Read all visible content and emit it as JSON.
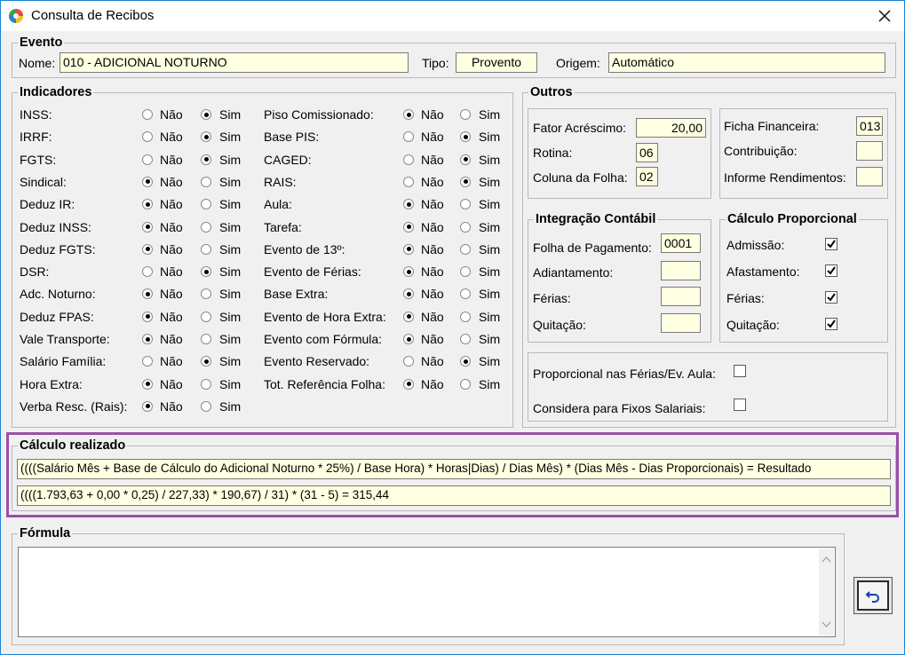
{
  "window": {
    "title": "Consulta de Recibos"
  },
  "evento": {
    "group_label": "Evento",
    "nome_label": "Nome:",
    "nome_value": "010 - ADICIONAL NOTURNO",
    "tipo_label": "Tipo:",
    "tipo_value": "Provento",
    "origem_label": "Origem:",
    "origem_value": "Automático"
  },
  "indicadores": {
    "group_label": "Indicadores",
    "no_label": "Não",
    "yes_label": "Sim",
    "left": [
      {
        "label": "INSS:",
        "selected": "Sim"
      },
      {
        "label": "IRRF:",
        "selected": "Sim"
      },
      {
        "label": "FGTS:",
        "selected": "Sim"
      },
      {
        "label": "Sindical:",
        "selected": "Não"
      },
      {
        "label": "Deduz IR:",
        "selected": "Não"
      },
      {
        "label": "Deduz INSS:",
        "selected": "Não"
      },
      {
        "label": "Deduz FGTS:",
        "selected": "Não"
      },
      {
        "label": "DSR:",
        "selected": "Sim"
      },
      {
        "label": "Adc. Noturno:",
        "selected": "Não"
      },
      {
        "label": "Deduz FPAS:",
        "selected": "Não"
      },
      {
        "label": "Vale Transporte:",
        "selected": "Não"
      },
      {
        "label": "Salário Família:",
        "selected": "Sim"
      },
      {
        "label": "Hora Extra:",
        "selected": "Não"
      },
      {
        "label": "Verba Resc. (Rais):",
        "selected": "Não"
      }
    ],
    "right": [
      {
        "label": "Piso Comissionado:",
        "selected": "Não"
      },
      {
        "label": "Base PIS:",
        "selected": "Sim"
      },
      {
        "label": "CAGED:",
        "selected": "Sim"
      },
      {
        "label": "RAIS:",
        "selected": "Sim"
      },
      {
        "label": "Aula:",
        "selected": "Não"
      },
      {
        "label": "Tarefa:",
        "selected": "Não"
      },
      {
        "label": "Evento de 13º:",
        "selected": "Não"
      },
      {
        "label": "Evento de Férias:",
        "selected": "Não"
      },
      {
        "label": "Base Extra:",
        "selected": "Não"
      },
      {
        "label": "Evento de Hora Extra:",
        "selected": "Não"
      },
      {
        "label": "Evento com Fórmula:",
        "selected": "Não"
      },
      {
        "label": "Evento Reservado:",
        "selected": "Sim"
      },
      {
        "label": "Tot. Referência Folha:",
        "selected": "Não"
      }
    ]
  },
  "outros": {
    "group_label": "Outros",
    "fator_label": "Fator Acréscimo:",
    "fator_value": "20,00",
    "rotina_label": "Rotina:",
    "rotina_value": "06",
    "coluna_label": "Coluna da Folha:",
    "coluna_value": "02",
    "ficha_label": "Ficha Financeira:",
    "ficha_value": "013",
    "contrib_label": "Contribuição:",
    "contrib_value": "",
    "informe_label": "Informe Rendimentos:",
    "informe_value": ""
  },
  "integracao": {
    "group_label": "Integração Contábil",
    "folha_label": "Folha de Pagamento:",
    "folha_value": "0001",
    "adiant_label": "Adiantamento:",
    "adiant_value": "",
    "ferias_label": "Férias:",
    "ferias_value": "",
    "quit_label": "Quitação:",
    "quit_value": ""
  },
  "proporcional": {
    "group_label": "Cálculo Proporcional",
    "items": [
      {
        "label": "Admissão:",
        "checked": true
      },
      {
        "label": "Afastamento:",
        "checked": true
      },
      {
        "label": "Férias:",
        "checked": true
      },
      {
        "label": "Quitação:",
        "checked": true
      }
    ]
  },
  "extras": {
    "prop_ferias_label": "Proporcional nas Férias/Ev. Aula:",
    "prop_ferias_checked": false,
    "fixos_label": "Considera para Fixos Salariais:",
    "fixos_checked": false
  },
  "calculo": {
    "group_label": "Cálculo realizado",
    "formula_text": "((((Salário Mês + Base de Cálculo do Adicional Noturno * 25%) / Base Hora) * Horas|Dias) / Dias Mês) * (Dias Mês - Dias Proporcionais) = Resultado",
    "result_text": "((((1.793,63 + 0,00 * 0,25) / 227,33) * 190,67) / 31) * (31 - 5) = 315,44"
  },
  "formula": {
    "group_label": "Fórmula",
    "value": ""
  },
  "colors": {
    "field_bg": "#ffffe1",
    "highlight": "#9a4fa6",
    "title_border": "#1883d7"
  },
  "icons": {
    "app": "app-globe-icon",
    "close": "close-icon",
    "undo": "undo-icon"
  }
}
